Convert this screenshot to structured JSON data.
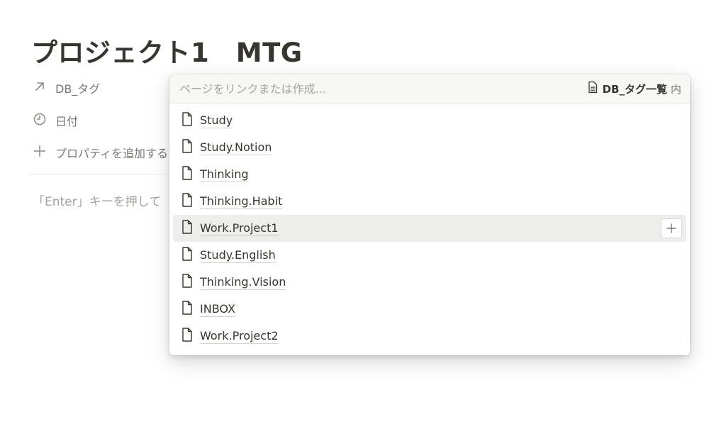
{
  "page": {
    "title": "プロジェクト1　MTG"
  },
  "properties": [
    {
      "label": "DB_タグ",
      "icon": "relation-arrow-icon"
    },
    {
      "label": "日付",
      "icon": "clock-icon"
    },
    {
      "label": "プロパティを追加する",
      "icon": "plus-icon"
    }
  ],
  "editor": {
    "placeholder": "「Enter」キーを押して"
  },
  "popup": {
    "search_placeholder": "ページをリンクまたは作成...",
    "database_name": "DB_タグ一覧",
    "database_suffix": "内",
    "items": [
      {
        "label": "Study"
      },
      {
        "label": "Study.Notion"
      },
      {
        "label": "Thinking"
      },
      {
        "label": "Thinking.Habit"
      },
      {
        "label": "Work.Project1",
        "active": true
      },
      {
        "label": "Study.English"
      },
      {
        "label": "Thinking.Vision"
      },
      {
        "label": "INBOX"
      },
      {
        "label": "Work.Project2"
      }
    ]
  },
  "colors": {
    "text": "#37352f",
    "muted": "#787774",
    "hover": "#ededeb"
  }
}
